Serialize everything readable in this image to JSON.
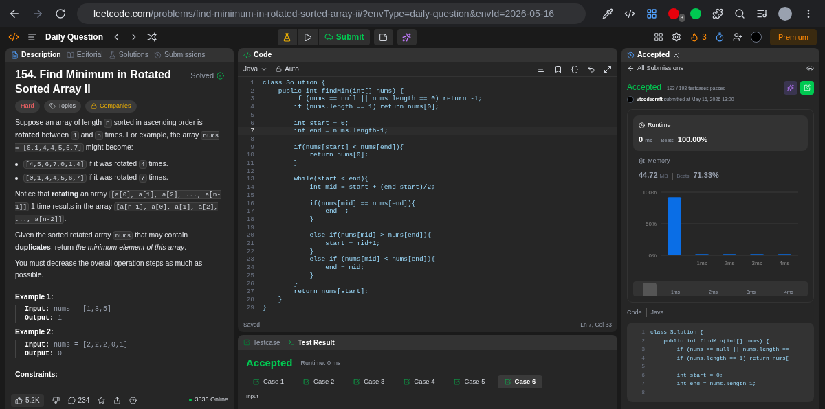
{
  "browser": {
    "url_host": "leetcode.com",
    "url_path": "/problems/find-minimum-in-rotated-sorted-array-ii/?envType=daily-question&envId=2026-05-16",
    "ext_badge": "3"
  },
  "header": {
    "title": "Daily Question",
    "submit": "Submit",
    "streak": "3",
    "premium": "Premium"
  },
  "left": {
    "tabs": [
      {
        "label": "Description",
        "selected": true
      },
      {
        "label": "Editorial",
        "selected": false
      },
      {
        "label": "Solutions",
        "selected": false
      },
      {
        "label": "Submissions",
        "selected": false
      }
    ],
    "title": "154. Find Minimum in Rotated Sorted Array II",
    "status": "Solved",
    "tags": [
      "Hard",
      "Topics",
      "Companies"
    ],
    "paragraphs": [
      [
        {
          "kind": "text",
          "text": "Suppose an array of length "
        },
        {
          "kind": "code",
          "text": "n"
        },
        {
          "kind": "text",
          "text": " sorted in ascending order is **rotated** between "
        },
        {
          "kind": "code",
          "text": "1"
        },
        {
          "kind": "text",
          "text": " and "
        },
        {
          "kind": "code",
          "text": "n"
        },
        {
          "kind": "text",
          "text": " times. For example, the array "
        },
        {
          "kind": "code",
          "text": "nums = [0,1,4,4,5,6,7]"
        },
        {
          "kind": "text",
          "text": " might become:"
        }
      ]
    ],
    "bullets": [
      [
        {
          "kind": "code",
          "text": "[4,5,6,7,0,1,4]"
        },
        {
          "kind": "text",
          "text": " if it was rotated "
        },
        {
          "kind": "code",
          "text": "4"
        },
        {
          "kind": "text",
          "text": " times."
        }
      ],
      [
        {
          "kind": "code",
          "text": "[0,1,4,4,5,6,7]"
        },
        {
          "kind": "text",
          "text": " if it was rotated "
        },
        {
          "kind": "code",
          "text": "7"
        },
        {
          "kind": "text",
          "text": " times."
        }
      ]
    ],
    "paragraphs2": [
      [
        {
          "kind": "text",
          "text": "Notice that **rotating** an array "
        },
        {
          "kind": "code",
          "text": "[a[0], a[1], a[2], ..., a[n-1]]"
        },
        {
          "kind": "text",
          "text": " 1 time results in the array "
        },
        {
          "kind": "code",
          "text": "[a[n-1], a[0], a[1], a[2], ..., a[n-2]]"
        },
        {
          "kind": "text",
          "text": "."
        }
      ],
      [
        {
          "kind": "text",
          "text": "Given the sorted rotated array "
        },
        {
          "kind": "code",
          "text": "nums"
        },
        {
          "kind": "text",
          "text": " that may contain **duplicates**, return *the minimum element of this array*."
        }
      ],
      [
        {
          "kind": "text",
          "text": "You must decrease the overall operation steps as much as possible."
        }
      ]
    ],
    "examples": [
      {
        "title": "Example 1:",
        "input_label": "Input:",
        "input": "nums = [1,3,5]",
        "output_label": "Output:",
        "output": "1"
      },
      {
        "title": "Example 2:",
        "input_label": "Input:",
        "input": "nums = [2,2,2,0,1]",
        "output_label": "Output:",
        "output": "0"
      }
    ],
    "constraints_title": "Constraints:",
    "footer": {
      "likes": "5.2K",
      "comments": "234",
      "online": "3536 Online"
    }
  },
  "editor": {
    "tab": "Code",
    "language": "Java",
    "mode": "Auto",
    "lines": [
      {
        "num": "1",
        "code": "class Solution {",
        "current": false
      },
      {
        "num": "2",
        "code": "    public int findMin(int[] nums) {",
        "current": false
      },
      {
        "num": "3",
        "code": "        if (nums == null || nums.length == 0) return -1;",
        "current": false
      },
      {
        "num": "4",
        "code": "        if (nums.length == 1) return nums[0];",
        "current": false
      },
      {
        "num": "5",
        "current": false
      },
      {
        "num": "6",
        "code": "        int start = 0;",
        "current": false
      },
      {
        "num": "7",
        "code": "        int end = nums.length-1;",
        "current": true
      },
      {
        "num": "8",
        "current": false
      },
      {
        "num": "9",
        "code": "        if(nums[start] < nums[end]){",
        "current": false
      },
      {
        "num": "10",
        "code": "            return nums[0];",
        "current": false
      },
      {
        "num": "11",
        "code": "        }",
        "current": false
      },
      {
        "num": "12",
        "current": false
      },
      {
        "num": "13",
        "code": "        while(start < end){",
        "current": false
      },
      {
        "num": "14",
        "code": "            int mid = start + (end-start)/2;",
        "current": false
      },
      {
        "num": "15",
        "current": false
      },
      {
        "num": "16",
        "code": "            if(nums[mid] == nums[end]){",
        "current": false
      },
      {
        "num": "17",
        "code": "                end--;",
        "current": false
      },
      {
        "num": "18",
        "code": "            }",
        "current": false
      },
      {
        "num": "19",
        "current": false
      },
      {
        "num": "20",
        "code": "            else if(nums[mid] > nums[end]){",
        "current": false
      },
      {
        "num": "21",
        "code": "                start = mid+1;",
        "current": false
      },
      {
        "num": "22",
        "code": "            }",
        "current": false
      },
      {
        "num": "23",
        "code": "            else if (nums[mid] < nums[end]){",
        "current": false
      },
      {
        "num": "24",
        "code": "                end = mid;",
        "current": false
      },
      {
        "num": "25",
        "code": "            }",
        "current": false
      },
      {
        "num": "26",
        "code": "        }",
        "current": false
      },
      {
        "num": "27",
        "code": "        return nums[start];",
        "current": false
      },
      {
        "num": "28",
        "code": "    }",
        "current": false
      },
      {
        "num": "29",
        "code": "}",
        "current": false
      }
    ],
    "status": "Saved",
    "position": "Ln 7, Col 33"
  },
  "test": {
    "tabs": [
      {
        "label": "Testcase",
        "selected": false
      },
      {
        "label": "Test Result",
        "selected": true
      }
    ],
    "verdict": "Accepted",
    "runtime": "Runtime: 0 ms",
    "cases": [
      {
        "label": "Case 1",
        "selected": false
      },
      {
        "label": "Case 2",
        "selected": false
      },
      {
        "label": "Case 3",
        "selected": false
      },
      {
        "label": "Case 4",
        "selected": false
      },
      {
        "label": "Case 5",
        "selected": false
      },
      {
        "label": "Case 6",
        "selected": true
      }
    ],
    "input_label": "Input"
  },
  "right": {
    "tab": "Accepted",
    "back": "All Submissions",
    "verdict": "Accepted",
    "passed": "193 / 193 testcases passed",
    "user": "vtcodecraft",
    "submitted": "submitted at May 16, 2026 13:00",
    "runtime": {
      "title": "Runtime",
      "value": "0",
      "unit": "ms",
      "beats_label": "Beats",
      "beats": "100.00%"
    },
    "memory": {
      "title": "Memory",
      "value": "44.72",
      "unit": "MB",
      "beats_label": "Beats",
      "beats": "71.33%"
    },
    "chart_data": {
      "type": "bar",
      "categories": [
        null,
        "1ms",
        "2ms",
        "3ms",
        "4ms"
      ],
      "series": [
        {
          "color": "#0a6ee6",
          "values": [
            92,
            2,
            2,
            2,
            2
          ]
        }
      ],
      "ylim": [
        0,
        100
      ],
      "yticks": [
        {
          "value": 0,
          "label": "0%"
        },
        {
          "value": 50,
          "label": "50%"
        },
        {
          "value": 100,
          "label": "100%"
        }
      ]
    },
    "scrub_labels": [
      "1ms",
      "2ms",
      "3ms",
      "4ms"
    ],
    "code_label": "Code",
    "code_lang": "Java",
    "code_lines": [
      {
        "num": "1",
        "code": "class Solution {"
      },
      {
        "num": "2",
        "code": "    public int findMin(int[] nums) {"
      },
      {
        "num": "3",
        "code": "        if (nums == null || nums.length =="
      },
      {
        "num": "4",
        "code": "        if (nums.length == 1) return nums["
      },
      {
        "num": "5"
      },
      {
        "num": "6",
        "code": "        int start = 0;"
      },
      {
        "num": "7",
        "code": "        int end = nums.length-1;"
      },
      {
        "num": "8"
      }
    ]
  }
}
